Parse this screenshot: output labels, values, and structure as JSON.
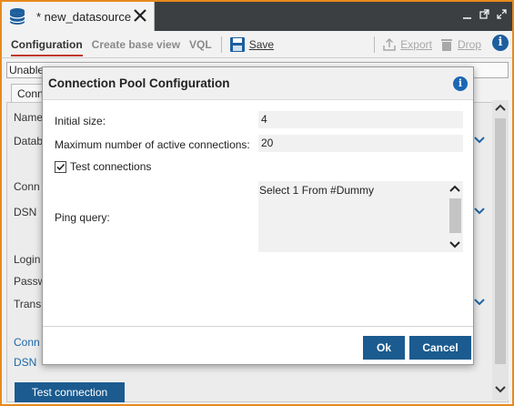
{
  "tab": {
    "title": "* new_datasource"
  },
  "toolbar": {
    "tabs": [
      "Configuration",
      "Create base view",
      "VQL"
    ],
    "save_label": "Save",
    "export_label": "Export",
    "drop_label": "Drop"
  },
  "background": {
    "warning": "Unable",
    "subtab": "Conn",
    "labels": [
      "Name",
      "Datab",
      "Conn",
      "DSN",
      "Login",
      "Passw",
      "Trans"
    ],
    "link1": "Conn",
    "link2": "DSN",
    "test_button": "Test connection"
  },
  "dialog": {
    "title": "Connection Pool Configuration",
    "initial_size_label": "Initial size:",
    "initial_size_value": "4",
    "max_active_label": "Maximum number of active connections:",
    "max_active_value": "20",
    "test_connections_label": "Test connections",
    "test_connections_checked": true,
    "ping_query_label": "Ping query:",
    "ping_query_value": "Select 1 From #Dummy",
    "ok_label": "Ok",
    "cancel_label": "Cancel"
  },
  "colors": {
    "accent_border": "#e78a1e",
    "primary_button": "#1b5b8f",
    "active_tab_underline": "#c0392b",
    "info_icon": "#1d66b4"
  }
}
